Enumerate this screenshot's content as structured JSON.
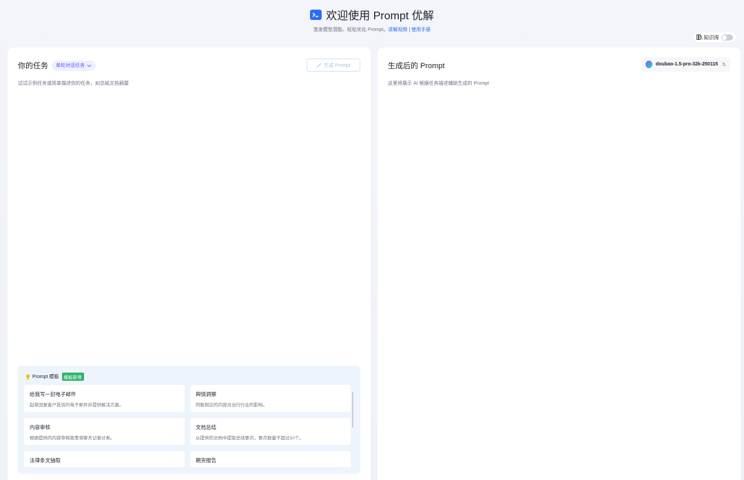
{
  "header": {
    "title": "欢迎使用 Prompt 优解",
    "subtitle_text": "激发模型潜能、轻松优化 Prompt。",
    "link_video": "讲解视频",
    "separator": " | ",
    "link_manual": "使用手册",
    "kb_label": "知识库",
    "kb_enabled": false
  },
  "left": {
    "title": "你的任务",
    "mode_label": "单轮对话任务",
    "generate_label": "生成 Prompt",
    "placeholder": "试试示例任务或简单描述你的任务，如总结文档摘要",
    "templates": {
      "title": "Prompt 模板",
      "badge": "模板新增",
      "items": [
        {
          "title": "给我写一封电子邮件",
          "desc": "起草回复客户投诉的电子邮件并提供解决方案。"
        },
        {
          "title": "舆情洞察",
          "desc": "判断舆论的内容对出行行业的影响。"
        },
        {
          "title": "内容审核",
          "desc": "根据提供的内容审核政策将聊天记录分类。"
        },
        {
          "title": "文档总结",
          "desc": "从提供的文档中提取总结要点，要点数量不超过10个。"
        },
        {
          "title": "法律条文抽取",
          "desc": ""
        },
        {
          "title": "期货报告",
          "desc": ""
        }
      ]
    }
  },
  "right": {
    "title": "生成后的 Prompt",
    "model": "doubao-1.5-pro-32k-250115",
    "placeholder": "这里将展示 AI 根据任务描述辅助生成的 Prompt"
  },
  "colors": {
    "accent": "#2b6ef6",
    "mode_tag": "#5b5bf5",
    "badge": "#33b36b"
  }
}
